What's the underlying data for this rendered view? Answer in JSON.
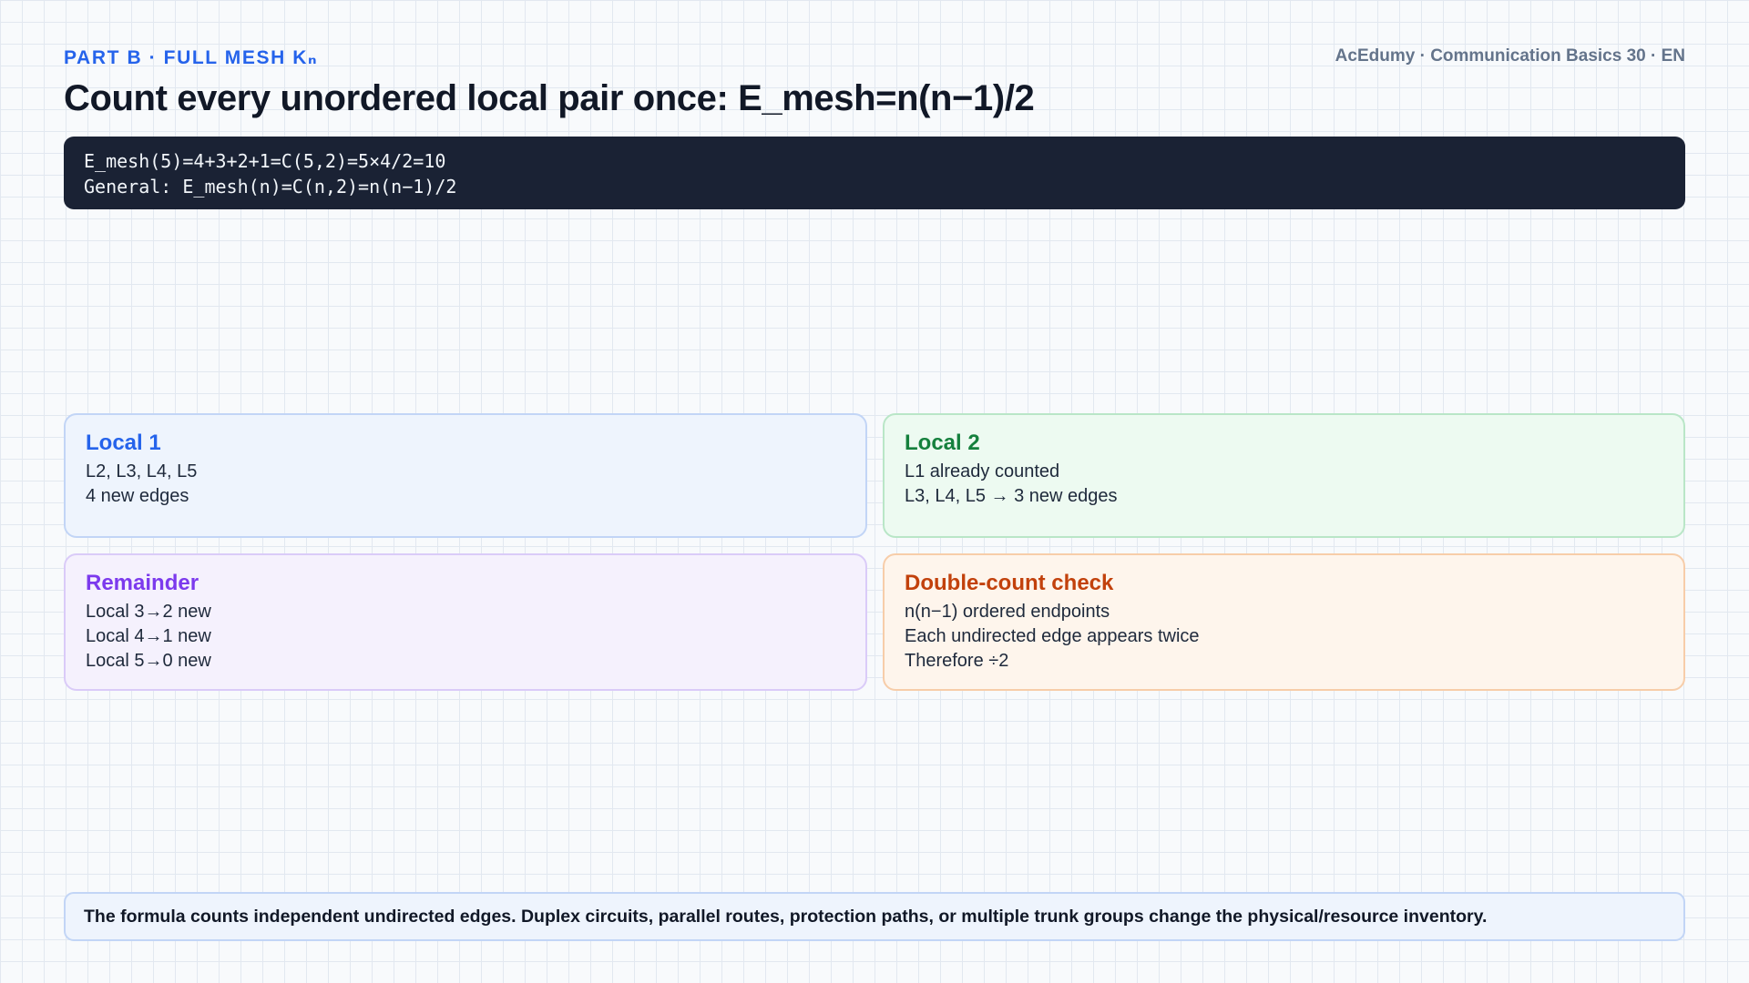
{
  "header": {
    "kicker": "PART B · FULL MESH Kₙ",
    "brand": "AcEdumy · Communication Basics 30 · EN",
    "title": "Count every unordered local pair once: E_mesh=n(n−1)/2"
  },
  "formula_panel": {
    "lines": [
      "E_mesh(5)=4+3+2+1=C(5,2)=5×4/2=10",
      "General: E_mesh(n)=C(n,2)=n(n−1)/2"
    ]
  },
  "cards": [
    {
      "title": "Local 1",
      "lines": [
        "L2, L3, L4, L5",
        "4 new edges"
      ],
      "accent": "#2563eb"
    },
    {
      "title": "Local 2",
      "lines": [
        "L1 already counted",
        "L3, L4, L5 → 3 new edges"
      ],
      "accent": "#15803d"
    },
    {
      "title": "Remainder",
      "lines": [
        "Local 3→2 new",
        "Local 4→1 new",
        "Local 5→0 new"
      ],
      "accent": "#7c3aed"
    },
    {
      "title": "Double-count check",
      "lines": [
        "n(n−1) ordered endpoints",
        "Each undirected edge appears twice",
        "Therefore ÷2"
      ],
      "accent": "#c2410c"
    }
  ],
  "footer": {
    "note": "The formula counts independent undirected edges. Duplex circuits, parallel routes, protection paths, or multiple trunk groups change the physical/resource inventory."
  }
}
